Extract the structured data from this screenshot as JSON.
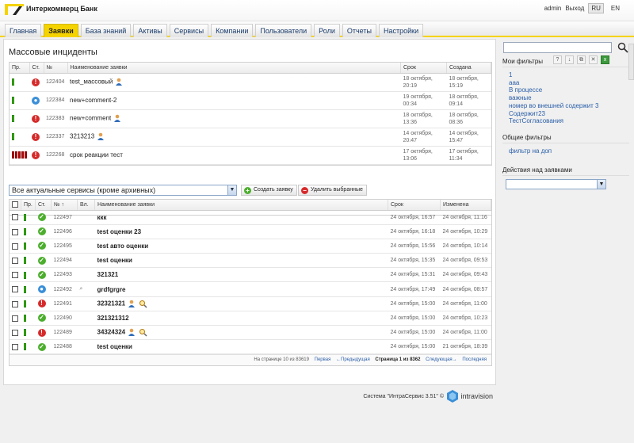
{
  "app": {
    "bank_name": "Интеркоммерц Банк"
  },
  "user": {
    "name": "admin",
    "logout": "Выход",
    "lang_active": "RU",
    "lang_other": "EN"
  },
  "nav": {
    "tabs": [
      "Главная",
      "Заявки",
      "База знаний",
      "Активы",
      "Сервисы",
      "Компании",
      "Пользователи",
      "Роли",
      "Отчеты",
      "Настройки"
    ],
    "active": "Заявки"
  },
  "mass": {
    "title": "Массовые инциденты",
    "headers": {
      "pri": "Пр.",
      "st": "Ст.",
      "num": "№",
      "name": "Наименование заявки",
      "due": "Срок",
      "created": "Создана"
    },
    "rows": [
      {
        "num": "122404",
        "name": "test_массовый",
        "due": "18 октября, 20:19",
        "created": "18 октября, 15:19",
        "status": "red",
        "priority": "green",
        "user_icon": true
      },
      {
        "num": "122384",
        "name": "new+comment-2",
        "due": "19 октября, 00:34",
        "created": "18 октября, 09:14",
        "status": "blue",
        "priority": "green",
        "user_icon": false
      },
      {
        "num": "122383",
        "name": "new+comment",
        "due": "18 октября, 13:36",
        "created": "18 октября, 08:36",
        "status": "red",
        "priority": "green",
        "user_icon": true
      },
      {
        "num": "122337",
        "name": "3213213",
        "due": "14 октября, 20:47",
        "created": "14 октября, 15:47",
        "status": "red",
        "priority": "green",
        "user_icon": true
      },
      {
        "num": "122268",
        "name": "срок реакции тест",
        "due": "17 октября, 13:06",
        "created": "17 октября, 11:34",
        "status": "red",
        "priority": "red",
        "user_icon": false
      }
    ]
  },
  "filter": {
    "service_select": "Все актуальные сервисы (кроме архивных)",
    "create_btn": "Создать заявку",
    "delete_btn": "Удалить выбранные"
  },
  "list": {
    "headers": {
      "pri": "Пр.",
      "st": "Ст.",
      "num": "№ ↑",
      "att": "Вл.",
      "name": "Наименование заявки",
      "due": "Срок",
      "changed": "Изменена"
    },
    "rows": [
      {
        "num": "122497",
        "name": "ккк",
        "due": "24 октября, 16:57",
        "changed": "24 октября, 11:16",
        "status": "green",
        "attach": false,
        "icons": false
      },
      {
        "num": "122496",
        "name": "test оценки 23",
        "due": "24 октября, 16:18",
        "changed": "24 октября, 10:29",
        "status": "green",
        "attach": false,
        "icons": false
      },
      {
        "num": "122495",
        "name": "test авто оценки",
        "due": "24 октября, 15:56",
        "changed": "24 октября, 10:14",
        "status": "green",
        "attach": false,
        "icons": false
      },
      {
        "num": "122494",
        "name": "test оценки",
        "due": "24 октября, 15:35",
        "changed": "24 октября, 09:53",
        "status": "green",
        "attach": false,
        "icons": false
      },
      {
        "num": "122493",
        "name": "321321",
        "due": "24 октября, 15:31",
        "changed": "24 октября, 09:43",
        "status": "green",
        "attach": false,
        "icons": false
      },
      {
        "num": "122492",
        "name": "grdfgrgre",
        "due": "24 октября, 17:49",
        "changed": "24 октября, 08:57",
        "status": "blue",
        "attach": true,
        "icons": false
      },
      {
        "num": "122491",
        "name": "32321321",
        "due": "24 октября, 15:00",
        "changed": "24 октября, 11:00",
        "status": "red",
        "attach": false,
        "icons": true
      },
      {
        "num": "122490",
        "name": "321321312",
        "due": "24 октября, 15:00",
        "changed": "24 октября, 10:23",
        "status": "green",
        "attach": false,
        "icons": false
      },
      {
        "num": "122489",
        "name": "34324324",
        "due": "24 октября, 15:00",
        "changed": "24 октября, 11:00",
        "status": "red",
        "attach": false,
        "icons": true
      },
      {
        "num": "122488",
        "name": "test оценки",
        "due": "24 октября, 15:00",
        "changed": "21 октября, 18:39",
        "status": "green",
        "attach": false,
        "icons": false
      }
    ],
    "pager": {
      "per_page": "На странице 10 из 83619",
      "first": "Первая",
      "prev": "←Предыдущая",
      "current": "Страница 1 из 8362",
      "next": "Следующая→",
      "last": "Последняя"
    }
  },
  "footer": {
    "text": "Система \"ИнтраСервис 3.51\" ©",
    "brand": "intravision"
  },
  "sidebar": {
    "my_filters_title": "Мои фильтры",
    "my_filters": [
      "1",
      "ааа",
      "В процессе",
      "важные",
      "номер во внешней содержит 3",
      "Содержит23",
      "ТестСогласования"
    ],
    "common_filters_title": "Общие фильтры",
    "common_filters": [
      "фильтр на доп"
    ],
    "actions_title": "Действия над заявками"
  },
  "colors": {
    "accent": "#f5d300",
    "link": "#2a5ea8",
    "status_red": "#d62a2a",
    "status_green": "#4cae2d",
    "status_blue": "#3a8fd8"
  }
}
